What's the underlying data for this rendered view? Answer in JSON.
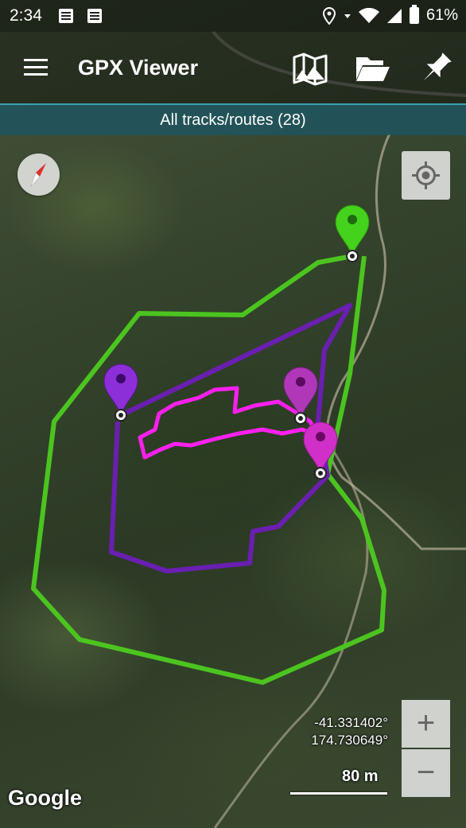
{
  "status_bar": {
    "time": "2:34",
    "battery_percent": "61%",
    "icons": [
      "notification-icon",
      "notification-icon",
      "location-icon",
      "wifi-icon",
      "signal-icon",
      "battery-icon"
    ]
  },
  "app_bar": {
    "menu_icon": "hamburger-menu-icon",
    "title": "GPX Viewer",
    "actions": [
      "map-icon",
      "folder-open-icon",
      "pin-icon"
    ]
  },
  "subtitle": "All tracks/routes (28)",
  "map": {
    "compass_icon": "compass-icon",
    "locate_icon": "crosshair-icon",
    "coordinates": {
      "latitude": "-41.331402°",
      "longitude": "174.730649°"
    },
    "scale_label": "80 m",
    "attribution": "Google",
    "zoom": {
      "in_label": "+",
      "out_label": "−"
    },
    "track_colors": {
      "green": "#4cc420",
      "purple": "#6a1fb0",
      "magenta": "#ff20f0"
    },
    "markers": [
      {
        "color": "#44d21c",
        "name": "green"
      },
      {
        "color": "#8c2fd8",
        "name": "purple"
      },
      {
        "color": "#b038b8",
        "name": "magenta"
      },
      {
        "color": "#d030c8",
        "name": "pink"
      }
    ]
  }
}
